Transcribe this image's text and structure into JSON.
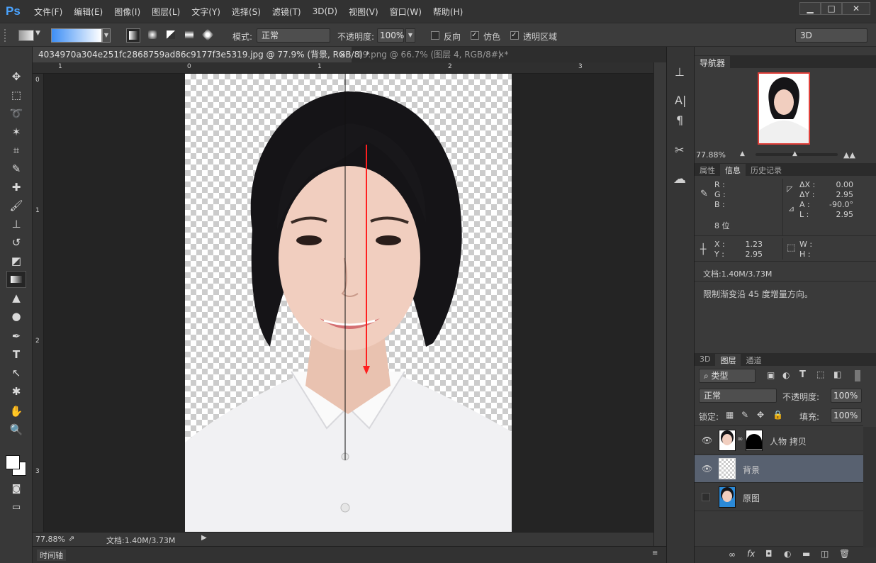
{
  "app": {
    "logo": "Ps"
  },
  "menu": [
    "文件(F)",
    "编辑(E)",
    "图像(I)",
    "图层(L)",
    "文字(Y)",
    "选择(S)",
    "滤镜(T)",
    "3D(D)",
    "视图(V)",
    "窗口(W)",
    "帮助(H)"
  ],
  "window_buttons": [
    "▁",
    "□",
    "✕"
  ],
  "options": {
    "mode_label": "模式:",
    "mode_value": "正常",
    "opacity_label": "不透明度:",
    "opacity_value": "100%",
    "reverse_label": "反向",
    "dither_label": "仿色",
    "transparency_label": "透明区域",
    "workspace_value": "3D"
  },
  "tabs": [
    {
      "label": "4034970a304e251fc2868759ad86c9177f3e5319.jpg @ 77.9% (背景, RGB/8) *",
      "close": "×"
    },
    {
      "label": "19.png @ 66.7% (图层 4, RGB/8#) *",
      "close": "×"
    }
  ],
  "ruler": {
    "h": [
      "1",
      "0",
      "1",
      "2",
      "3"
    ],
    "v": [
      "0",
      "1",
      "2",
      "3"
    ]
  },
  "status": {
    "zoom": "77.88%",
    "doc": "文档:1.40M/3.73M"
  },
  "timeline_label": "时间轴",
  "navigator": {
    "tab": "导航器",
    "zoom": "77.88%"
  },
  "info_panel": {
    "tabs": [
      "属性",
      "信息",
      "历史记录"
    ],
    "rgb_labels": [
      "R :",
      "G :",
      "B :"
    ],
    "bits": "8 位",
    "delta_labels": [
      "ΔX :",
      "ΔY :",
      "A :",
      "L :"
    ],
    "delta_values": [
      "0.00",
      "2.95",
      "-90.0°",
      "2.95"
    ],
    "xy_labels": [
      "X :",
      "Y :"
    ],
    "xy_values": [
      "1.23",
      "2.95"
    ],
    "wh_labels": [
      "W :",
      "H :"
    ],
    "doc": "文档:1.40M/3.73M",
    "hint": "限制渐变沿 45 度增量方向。"
  },
  "layers_panel": {
    "tabs": [
      "3D",
      "图层",
      "通道"
    ],
    "filter": "类型",
    "blend": "正常",
    "opacity_label": "不透明度:",
    "opacity_value": "100%",
    "lock_label": "锁定:",
    "fill_label": "填充:",
    "fill_value": "100%",
    "layers": [
      {
        "name": "人物 拷贝"
      },
      {
        "name": "背景"
      },
      {
        "name": "原图"
      }
    ]
  }
}
